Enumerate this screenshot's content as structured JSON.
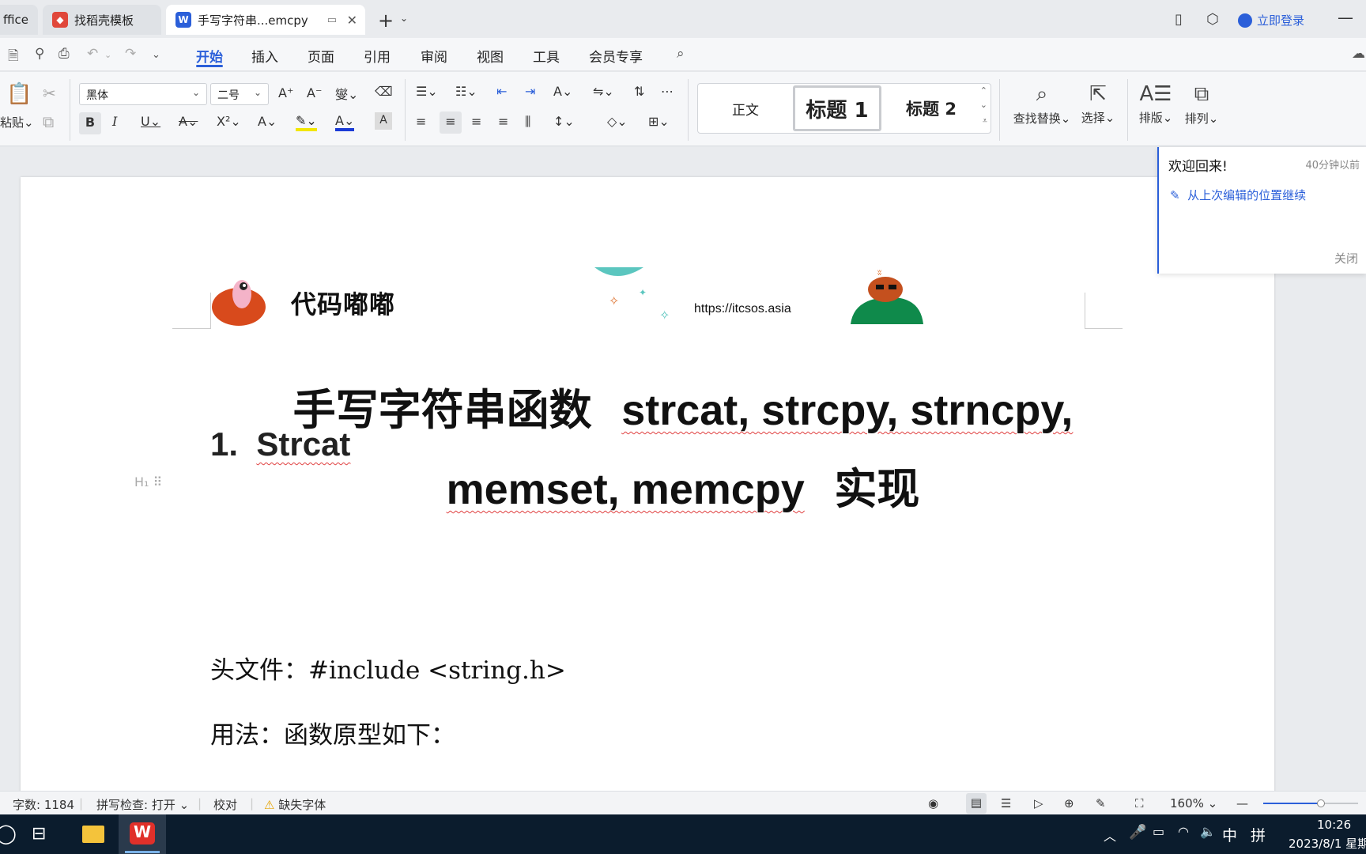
{
  "tabs": [
    {
      "label": "ffice",
      "active": false
    },
    {
      "label": "找稻壳模板",
      "active": false
    },
    {
      "label": "手写字符串...emcpy",
      "active": true
    }
  ],
  "login_label": "立即登录",
  "menu": {
    "items": [
      "开始",
      "插入",
      "页面",
      "引用",
      "审阅",
      "视图",
      "工具",
      "会员专享"
    ]
  },
  "ribbon": {
    "paste_label": "粘贴",
    "font_name": "黑体",
    "font_size": "二号",
    "styles": {
      "normal": "正文",
      "h1": "标题 1",
      "h2": "标题 2"
    },
    "find_replace": "查找替换",
    "select": "选择",
    "layout": "排版",
    "arrange": "排列"
  },
  "notification": {
    "title": "欢迎回来!",
    "time": "40分钟以前",
    "action": "从上次编辑的位置继续",
    "close": "关闭"
  },
  "document": {
    "header_brand": "代码嘟嘟",
    "header_url": "https://itcsos.asia",
    "title_cn": "手写字符串函数",
    "title_line1_en": "strcat, strcpy, strncpy,",
    "title_line2_en": "memset, memcpy",
    "title_line2_cn": "实现",
    "h1_num": "1.",
    "h1_text": "Strcat",
    "para1": "头文件：#include <string.h>",
    "para2": "用法：函数原型如下："
  },
  "statusbar": {
    "word_count": "字数: 1184",
    "spellcheck": "拼写检查: 打开",
    "proofread": "校对",
    "missing_font": "缺失字体",
    "zoom": "160%"
  },
  "taskbar": {
    "ime_lang": "中",
    "ime_mode": "拼",
    "time": "10:26",
    "date": "2023/8/1 星期"
  },
  "colors": {
    "accent": "#2b5fd9",
    "taskbar": "#0b1c2d",
    "spell_underline": "#e04040"
  }
}
